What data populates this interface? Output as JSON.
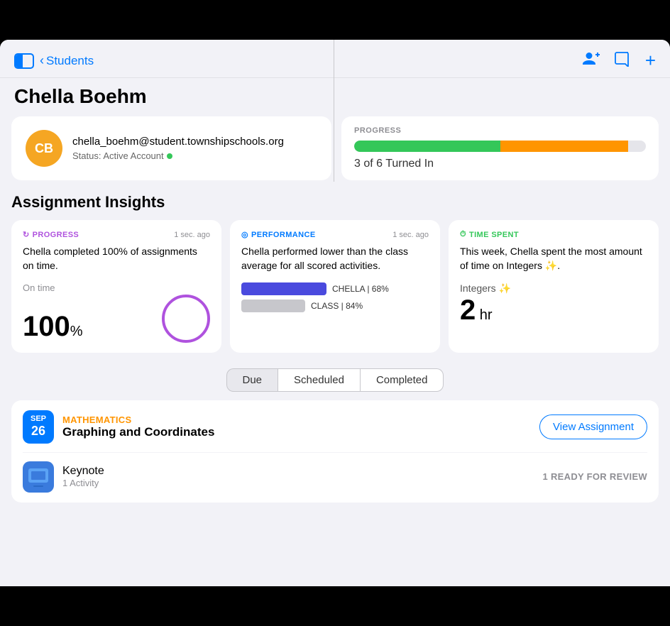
{
  "header": {
    "back_label": "Students",
    "sidebar_icon_label": "sidebar-toggle",
    "icons": [
      "person-add",
      "message",
      "add"
    ]
  },
  "page_title": "Chella Boehm",
  "profile": {
    "initials": "CB",
    "email": "chella_boehm@student.townshipschools.org",
    "status_label": "Status: Active Account",
    "avatar_bg": "#F5A623"
  },
  "progress": {
    "section_label": "PROGRESS",
    "green_pct": 50,
    "orange_pct": 44,
    "summary": "3 of 6 Turned In"
  },
  "insights_title": "Assignment Insights",
  "insights": [
    {
      "badge": "PROGRESS",
      "badge_icon": "↻",
      "timestamp": "1 sec. ago",
      "description": "Chella completed 100% of assignments on time.",
      "on_time_label": "On time",
      "value": "100",
      "unit": "%",
      "circle_color": "#AF52DE"
    },
    {
      "badge": "PERFORMANCE",
      "badge_icon": "◎",
      "timestamp": "1 sec. ago",
      "description": "Chella performed lower than the class average for all scored activities.",
      "chella_bar_label": "CHELLA | 68%",
      "class_bar_label": "CLASS | 84%",
      "chella_pct": 68,
      "class_pct": 84
    },
    {
      "badge": "TIME SPENT",
      "badge_icon": "⏱",
      "timestamp": "",
      "description": "This week, Chella spent the most amount of time on Integers ✨.",
      "subject": "Integers ✨",
      "value": "2",
      "unit": " hr"
    }
  ],
  "tabs": [
    {
      "label": "Due",
      "active": true
    },
    {
      "label": "Scheduled",
      "active": false
    },
    {
      "label": "Completed",
      "active": false
    }
  ],
  "assignment": {
    "date_month": "SEP",
    "date_day": "26",
    "subject": "MATHEMATICS",
    "name": "Graphing and Coordinates",
    "view_btn": "View Assignment",
    "item_name": "Keynote",
    "item_sub": "1 Activity",
    "item_badge": "1 READY FOR REVIEW"
  }
}
